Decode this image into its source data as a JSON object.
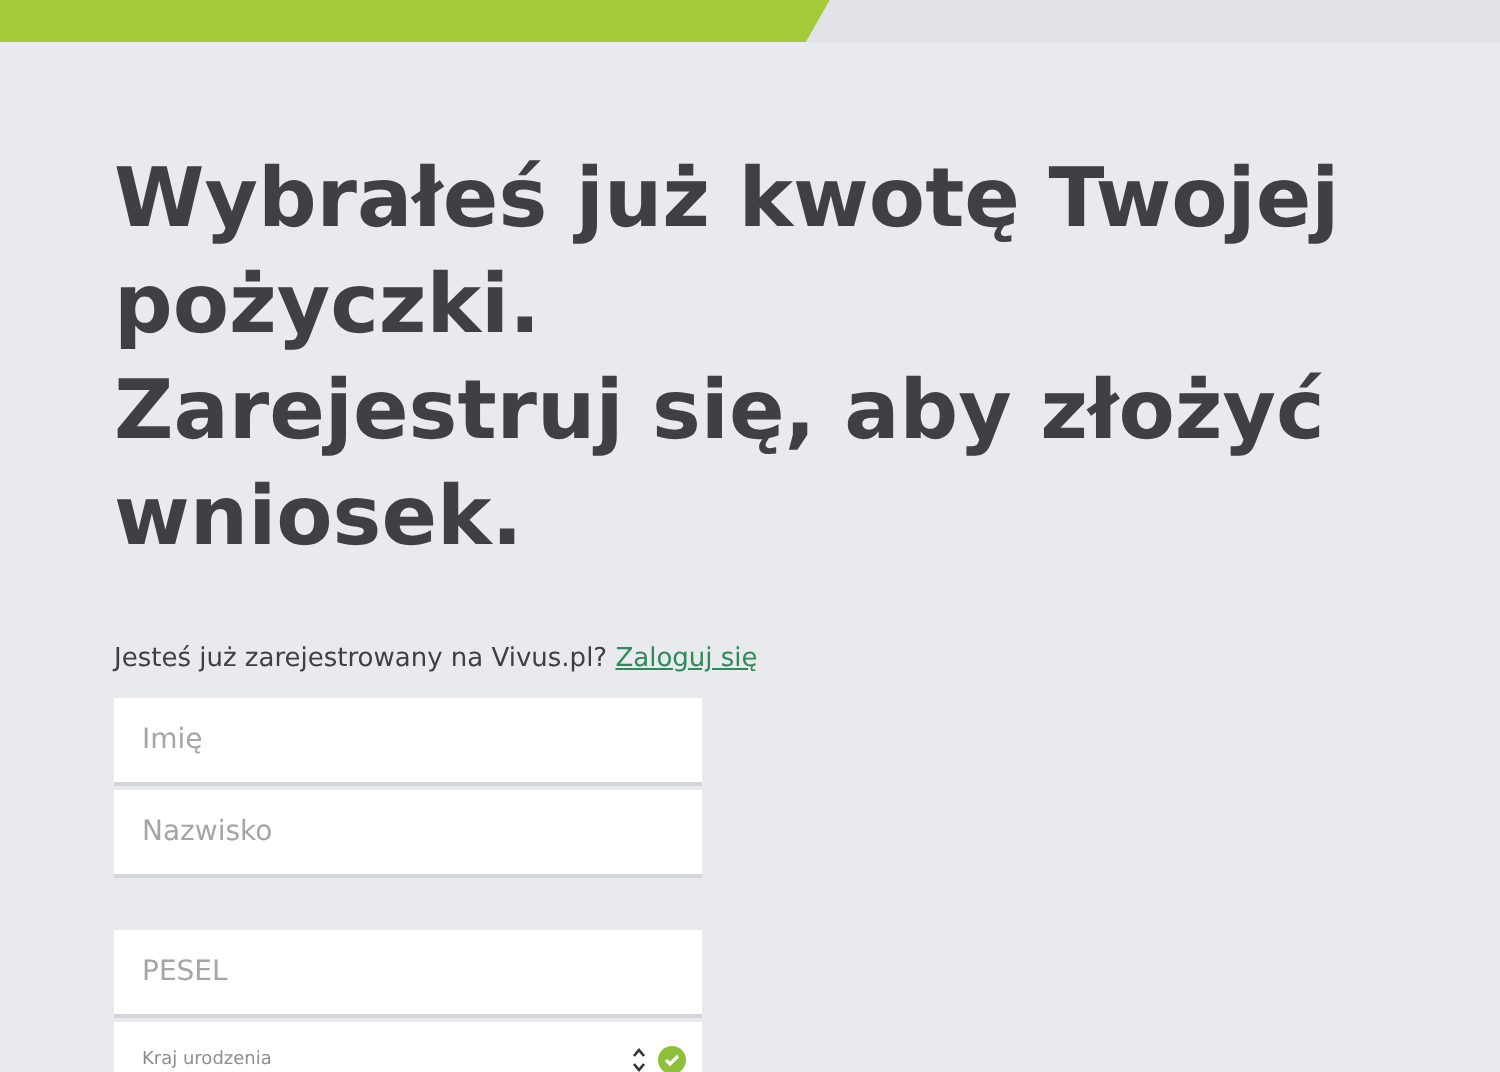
{
  "steps": [
    {
      "selected": true
    },
    {
      "selected": false
    }
  ],
  "heading": [
    "Wybrałeś już kwotę Twojej pożyczki.",
    "Zarejestruj się, aby złożyć wniosek."
  ],
  "login_prompt": {
    "text": "Jesteś już zarejestrowany na Vivus.pl?",
    "link": "Zaloguj się"
  },
  "fields": [
    {
      "kind": "input",
      "placeholder": "Imię"
    },
    {
      "kind": "input",
      "placeholder": "Nazwisko"
    },
    {
      "kind": "gap"
    },
    {
      "kind": "input",
      "placeholder": "PESEL"
    },
    {
      "kind": "select",
      "label": "Kraj urodzenia",
      "valid": true
    }
  ]
}
